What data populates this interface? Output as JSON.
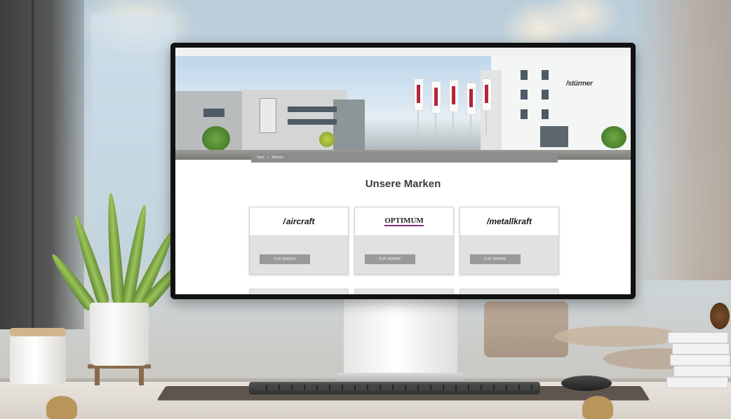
{
  "scene": {
    "description_labels": {
      "monitor": "desktop-monitor",
      "plant": "snake-plant",
      "books": "book-stack"
    }
  },
  "website": {
    "hero_sign_text": "/stürmer",
    "breadcrumb": {
      "home": "Start",
      "separator": "»",
      "current": "Marken"
    },
    "page_title": "Unsere Marken",
    "brands": [
      {
        "name": "aircraft",
        "logo_text": "aircraft",
        "button_label": "ZUR MARKE"
      },
      {
        "name": "optimum",
        "logo_text": "OPTIMUM",
        "button_label": "ZUR MARKE"
      },
      {
        "name": "metallkraft",
        "logo_text": "metallkraft",
        "button_label": "ZUR MARKE"
      }
    ]
  },
  "colors": {
    "optimum_accent": "#8c2a8c",
    "button_bg": "#9a9a9a",
    "breadcrumb_bg": "#8d8d8d"
  }
}
